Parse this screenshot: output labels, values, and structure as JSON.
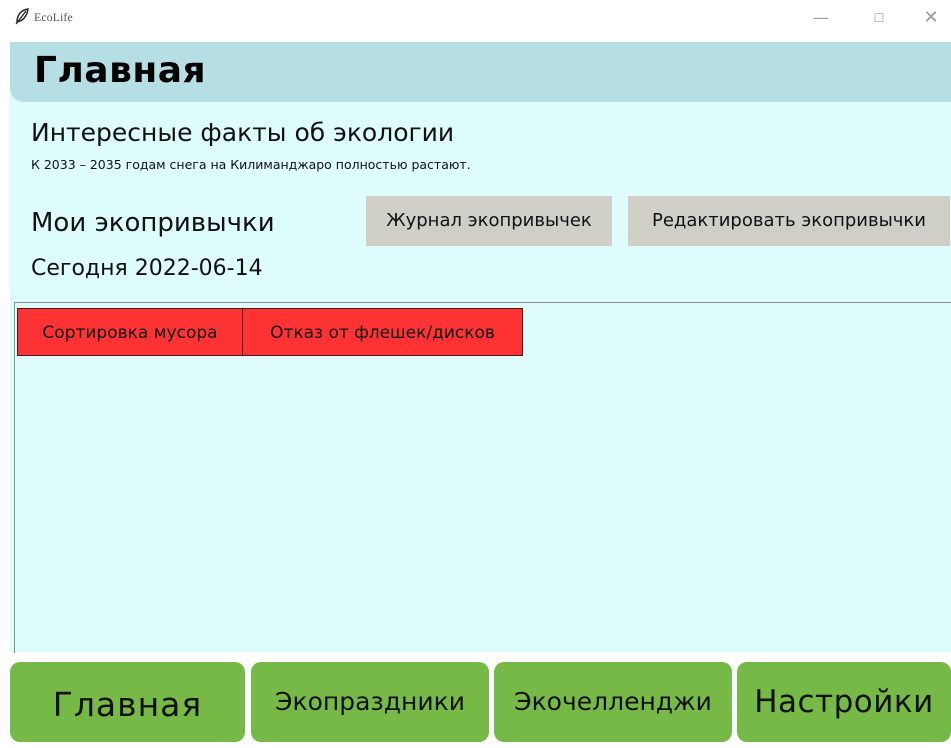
{
  "window": {
    "title": "EcoLife",
    "minimize": "—",
    "maximize": "☐",
    "close": "✕"
  },
  "header": {
    "title": "Главная"
  },
  "facts": {
    "title": "Интересные факты об экологии",
    "text": "К 2033 – 2035 годам снега на Килиманджаро полностью растают."
  },
  "habits": {
    "title": "Мои экопривычки",
    "journal_label": "Журнал экопривычек",
    "edit_label": "Редактировать экопривычки",
    "today": "Сегодня 2022-06-14",
    "items": [
      {
        "label": "Сортировка мусора"
      },
      {
        "label": "Отказ от флешек/дисков"
      }
    ]
  },
  "nav": {
    "main": "Главная",
    "holidays": "Экопраздники",
    "challenges": "Экочелленджи",
    "settings": "Настройки"
  },
  "colors": {
    "background": "#dffcfc",
    "header": "#b6dfe5",
    "habit_pending": "#ff3333",
    "nav_green": "#77b947",
    "button_gray": "#cfcfc8"
  }
}
